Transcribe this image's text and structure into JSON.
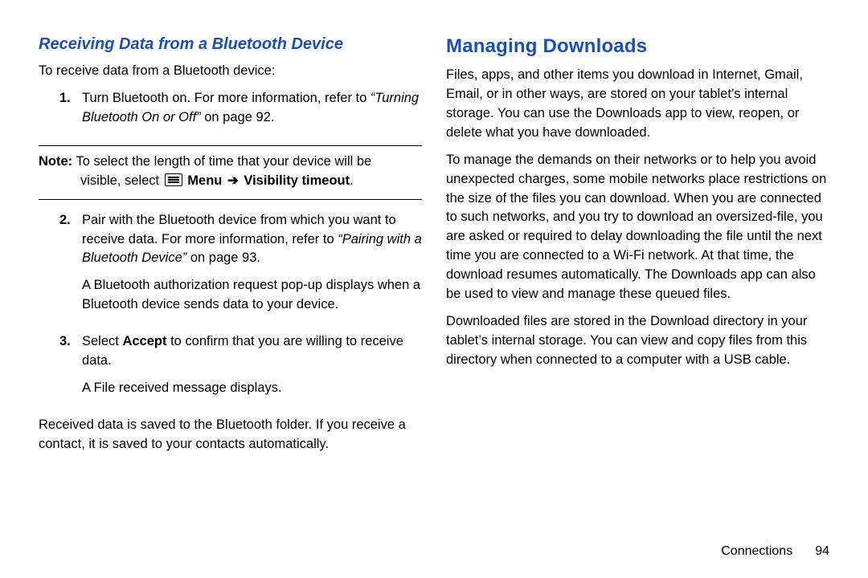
{
  "left": {
    "heading": "Receiving Data from a Bluetooth Device",
    "intro": "To receive data from a Bluetooth device:",
    "step1_num": "1.",
    "step1_a": "Turn Bluetooth on. For more information, refer to ",
    "step1_ref": "“Turning Bluetooth On or Off”",
    "step1_b": " on page 92.",
    "note_label": "Note:",
    "note_a": " To select the length of time that your device will be",
    "note_b_prefix": "visible, select ",
    "note_menu": " Menu ",
    "note_arrow": "➔",
    "note_timeout": " Visibility timeout",
    "note_period": ".",
    "step2_num": "2.",
    "step2_a": "Pair with the Bluetooth device from which you want to receive data. For more information, refer to ",
    "step2_ref": "“Pairing with a Bluetooth Device”",
    "step2_b": " on page 93.",
    "step2_c": "A Bluetooth authorization request pop-up displays when a Bluetooth device sends data to your device.",
    "step3_num": "3.",
    "step3_a": "Select ",
    "step3_accept": "Accept",
    "step3_b": " to confirm that you are willing to receive data.",
    "step3_c": "A File received message displays.",
    "closing": "Received data is saved to the Bluetooth folder. If you receive a contact, it is saved to your contacts automatically."
  },
  "right": {
    "heading": "Managing Downloads",
    "para1": "Files, apps, and other items you download in Internet, Gmail, Email, or in other ways, are stored on your tablet’s internal storage. You can use the Downloads app to view, reopen, or delete what you have downloaded.",
    "para2": "To manage the demands on their networks or to help you avoid unexpected charges, some mobile networks place restrictions on the size of the files you can download. When you are connected to such networks, and you try to download an oversized-file, you are asked or required to delay downloading the file until the next time you are connected to a Wi-Fi network. At that time, the download resumes automatically. The Downloads app can also be used to view and manage these queued files.",
    "para3": "Downloaded files are stored in the Download directory in your tablet’s internal storage. You can view and copy files from this directory when connected to a computer with a USB cable."
  },
  "footer": {
    "section": "Connections",
    "page": "94"
  }
}
